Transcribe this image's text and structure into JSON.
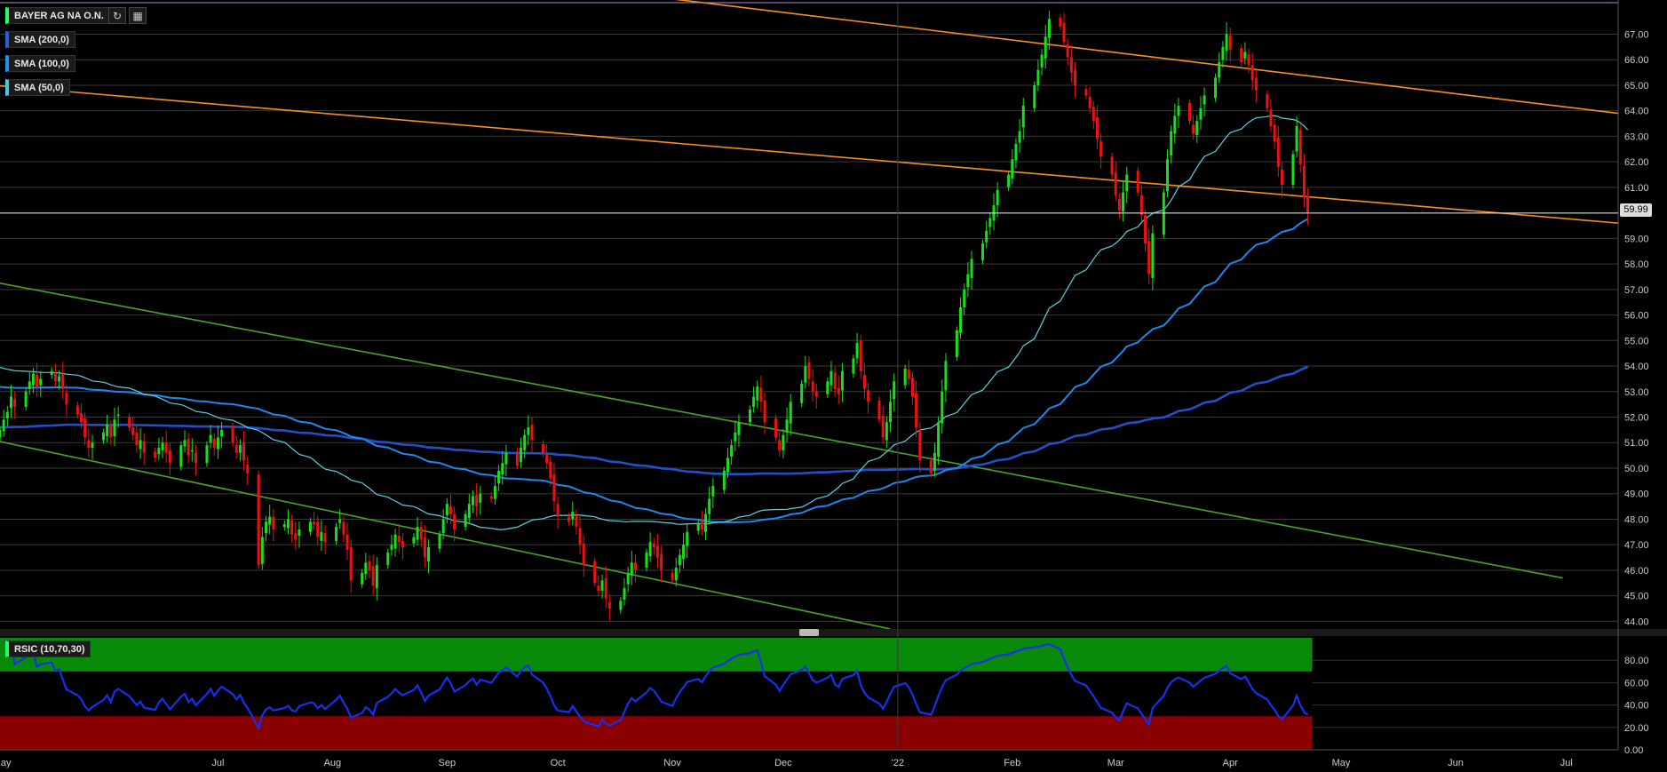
{
  "instrument": {
    "name": "BAYER AG NA O.N."
  },
  "toolbar": {
    "refresh_icon": "refresh-icon",
    "calculator_icon": "calculator-icon"
  },
  "indicators": {
    "sma200": "SMA (200,0)",
    "sma100": "SMA (100,0)",
    "sma50": "SMA (50,0)",
    "rsi": "RSIC (10,70,30)"
  },
  "current_price": "59.99",
  "colors": {
    "up": "#18e018",
    "down": "#ee1111",
    "sma200": "#2350c8",
    "sma100": "#1e88ee",
    "sma50": "#5fd0e0",
    "resistance": "#f5901e",
    "support": "#4aa428",
    "rsi_line": "#1530f0",
    "overbought": "#0a8a0a",
    "oversold": "#8a0000"
  },
  "chart_data": [
    {
      "type": "candlestick",
      "title": "BAYER AG NA O.N.",
      "y_ticks": [
        "67.00",
        "66.00",
        "65.00",
        "64.00",
        "63.00",
        "62.00",
        "61.00",
        "60.00",
        "59.00",
        "58.00",
        "57.00",
        "56.00",
        "55.00",
        "54.00",
        "53.00",
        "52.00",
        "51.00",
        "50.00",
        "49.00",
        "48.00",
        "47.00",
        "46.00",
        "45.00",
        "44.00"
      ],
      "x_ticks": [
        "May",
        "Jul",
        "Aug",
        "Sep",
        "Oct",
        "Nov",
        "Dec",
        "'22",
        "Feb",
        "Mar",
        "Apr",
        "May",
        "Jun",
        "Jul"
      ],
      "ylim": [
        43.7,
        68.2
      ],
      "x_range": [
        "2021-05-03",
        "2022-07-15"
      ],
      "last_close": 59.99,
      "grid": true,
      "ohlc_series": {
        "dates_start": "2021-05-03",
        "closes": [
          51.5,
          51.9,
          52.2,
          52.8,
          52.4,
          53.0,
          53.4,
          53.7,
          53.2,
          53.5,
          53.8,
          53.4,
          53.6,
          53.1,
          52.5,
          52.1,
          51.8,
          51.2,
          50.8,
          51.0,
          51.4,
          51.7,
          51.2,
          51.9,
          52.1,
          51.6,
          51.3,
          50.9,
          51.1,
          50.6,
          50.4,
          50.8,
          51.0,
          50.6,
          50.2,
          50.9,
          51.1,
          50.5,
          50.7,
          50.2,
          50.9,
          51.3,
          50.8,
          51.2,
          51.5,
          51.0,
          50.6,
          50.9,
          50.3,
          49.8,
          46.2,
          47.3,
          47.9,
          48.1,
          47.6,
          47.8,
          48.0,
          47.4,
          47.2,
          47.6,
          47.9,
          47.8,
          47.3,
          47.5,
          47.1,
          47.7,
          48.0,
          47.4,
          46.8,
          45.6,
          45.9,
          46.3,
          46.0,
          45.4,
          46.2,
          46.7,
          47.0,
          47.4,
          47.1,
          46.9,
          47.3,
          47.7,
          47.2,
          46.5,
          46.9,
          47.4,
          48.0,
          48.6,
          48.2,
          47.6,
          48.2,
          48.6,
          48.9,
          48.5,
          49.0,
          48.8,
          49.3,
          49.9,
          50.2,
          50.6,
          50.1,
          50.8,
          51.3,
          51.6,
          51.1,
          50.6,
          50.2,
          49.6,
          48.7,
          48.1,
          47.9,
          48.3,
          47.7,
          47.0,
          46.2,
          45.5,
          45.2,
          45.6,
          44.9,
          44.5,
          44.8,
          45.3,
          45.9,
          46.3,
          46.0,
          46.7,
          47.1,
          46.9,
          46.5,
          46.0,
          45.6,
          46.1,
          46.6,
          47.0,
          47.5,
          47.8,
          47.6,
          48.2,
          48.8,
          49.3,
          49.9,
          50.4,
          50.9,
          51.4,
          51.8,
          52.3,
          52.8,
          53.2,
          52.6,
          51.8,
          51.2,
          50.7,
          51.3,
          51.9,
          52.6,
          53.3,
          54.0,
          53.5,
          53.0,
          52.8,
          53.4,
          53.8,
          53.1,
          52.9,
          53.8,
          54.3,
          54.9,
          53.8,
          53.1,
          52.6,
          51.9,
          51.2,
          51.8,
          52.6,
          53.4,
          53.9,
          53.5,
          52.8,
          51.6,
          50.3,
          49.8,
          50.6,
          51.8,
          53.0,
          54.2,
          55.4,
          56.3,
          57.0,
          57.6,
          58.2,
          58.8,
          59.3,
          59.8,
          60.3,
          60.9,
          61.5,
          62.1,
          62.7,
          63.2,
          64.2,
          65.0,
          65.6,
          66.2,
          66.9,
          67.6,
          67.3,
          66.7,
          66.1,
          65.5,
          65.0,
          64.6,
          64.1,
          63.6,
          62.9,
          62.2,
          61.5,
          60.7,
          60.1,
          60.8,
          61.5,
          60.8,
          59.9,
          58.8,
          57.6,
          59.2,
          60.8,
          62.1,
          63.2,
          63.8,
          64.2,
          63.6,
          63.1,
          63.6,
          64.1,
          64.6,
          65.3,
          65.9,
          66.5,
          67.0,
          66.4,
          65.9,
          66.3,
          65.8,
          65.2,
          64.8,
          64.1,
          63.4,
          62.8,
          61.8,
          61.1,
          62.3,
          63.4,
          61.9,
          60.6,
          59.99
        ]
      }
    },
    {
      "type": "line",
      "title": "RSIC (10,70,30)",
      "y_ticks": [
        "80.00",
        "60.00",
        "40.00",
        "20.00",
        "0.00"
      ],
      "ylim": [
        0,
        100
      ],
      "overbought": 70,
      "oversold": 30
    }
  ]
}
